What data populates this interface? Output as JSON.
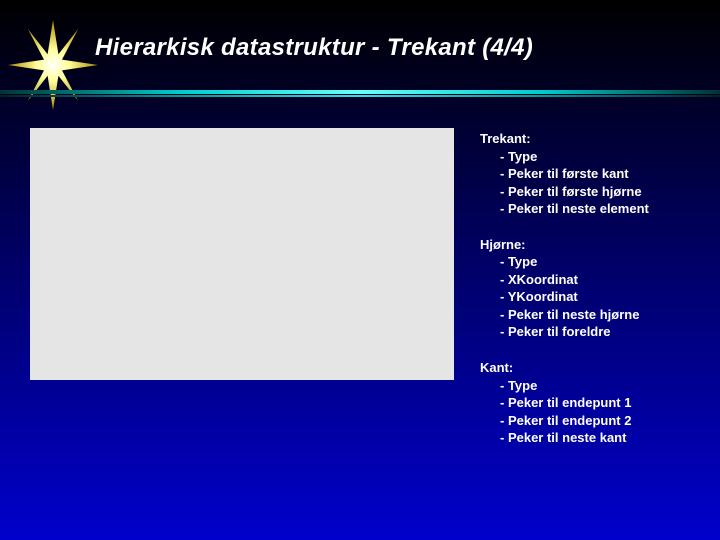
{
  "title": "Hierarkisk datastruktur   -   Trekant   (4/4)",
  "groups": [
    {
      "label": "Trekant:",
      "items": [
        "- Type",
        "- Peker til første kant",
        "- Peker til første hjørne",
        "- Peker til neste element"
      ]
    },
    {
      "label": "Hjørne:",
      "items": [
        "- Type",
        "- XKoordinat",
        "- YKoordinat",
        "- Peker til neste hjørne",
        "- Peker til foreldre"
      ]
    },
    {
      "label": "Kant:",
      "items": [
        "- Type",
        "- Peker til endepunt 1",
        "- Peker til endepunt 2",
        "- Peker til neste kant"
      ]
    }
  ]
}
